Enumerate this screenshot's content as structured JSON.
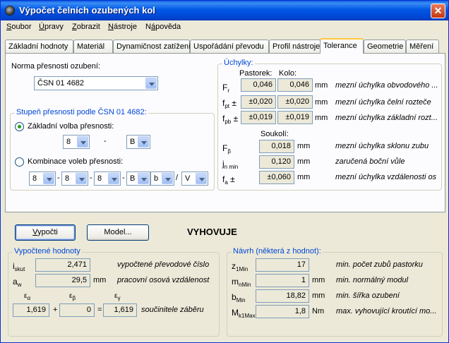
{
  "window": {
    "title": "Výpočet čelních ozubených kol",
    "close_symbol": "✕"
  },
  "menu": [
    {
      "pre": "",
      "acc": "S",
      "post": "oubor"
    },
    {
      "pre": "",
      "acc": "Ú",
      "post": "pravy"
    },
    {
      "pre": "",
      "acc": "Z",
      "post": "obrazit"
    },
    {
      "pre": "",
      "acc": "N",
      "post": "ástroje"
    },
    {
      "pre": "N",
      "acc": "á",
      "post": "pověda"
    }
  ],
  "tabs": [
    "Základní hodnoty",
    "Materiál",
    "Dynamičnost zatížení",
    "Uspořádání převodu",
    "Profil nástroje",
    "Tolerance",
    "Geometrie",
    "Měření"
  ],
  "active_tab": "Tolerance",
  "tolerance": {
    "norma_label": "Norma přesnosti ozubení:",
    "norma_value": "ČSN 01 4682",
    "stupen_title": "Stupeň přesnosti podle ČSN 01 4682:",
    "zakladni_label": "Základní volba přesnosti:",
    "zakladni_value1": "8",
    "dash": "-",
    "zakladni_value2": "B",
    "kombinace_label": "Kombinace voleb přesnosti:",
    "kombinace_values": [
      "8",
      "8",
      "8",
      "B",
      "b",
      "V"
    ],
    "kombinace_seps": [
      "-",
      "-",
      "-",
      "",
      "/"
    ],
    "uchylky_title": "Úchylky:",
    "pastorek_header": "Pastorek:",
    "kolo_header": "Kolo:",
    "soukoli_header": "Soukolí:",
    "rows": [
      {
        "sym": "F",
        "sub": "r",
        "suffix": "",
        "pastorek": "0,046",
        "kolo": "0,046",
        "unit": "mm",
        "desc": "mezní úchylka obvodového ..."
      },
      {
        "sym": "f",
        "sub": "pt",
        "suffix": " ±",
        "pastorek": "±0,020",
        "kolo": "±0,020",
        "unit": "mm",
        "desc": "mezní úchylka čelní rozteče"
      },
      {
        "sym": "f",
        "sub": "pb",
        "suffix": " ±",
        "pastorek": "±0,019",
        "kolo": "±0,019",
        "unit": "mm",
        "desc": "mezní úchylka základní rozt..."
      }
    ],
    "soukoli_rows": [
      {
        "sym": "F",
        "sub": "β",
        "suffix": "",
        "value": "0,018",
        "unit": "mm",
        "desc": "mezní úchylka sklonu zubu"
      },
      {
        "sym": "j",
        "sub": "n min",
        "suffix": "",
        "value": "0,120",
        "unit": "mm",
        "desc": "zaručená boční vůle"
      },
      {
        "sym": "f",
        "sub": "a",
        "suffix": " ±",
        "value": "±0,060",
        "unit": "mm",
        "desc": "mezní úchylka vzdálenosti os"
      }
    ]
  },
  "buttons": {
    "vypocti_pre": "",
    "vypocti_acc": "V",
    "vypocti_post": "ypočti",
    "model": "Model..."
  },
  "status": "VYHOVUJE",
  "vypoctene": {
    "title": "Vypočtené hodnoty",
    "rows": [
      {
        "sym": "i",
        "sub": "skut",
        "value": "2,471",
        "unit": "",
        "desc": "vypočtené převodové číslo"
      },
      {
        "sym": "a",
        "sub": "w",
        "value": "29,5",
        "unit": "mm",
        "desc": "pracovní osová vzdálenost"
      }
    ],
    "eps": [
      {
        "sym": "ε",
        "sub": "α",
        "value": "1,619"
      },
      {
        "sym": "ε",
        "sub": "β",
        "value": "0"
      },
      {
        "sym": "ε",
        "sub": "γ",
        "value": "1,619"
      }
    ],
    "plus": "+",
    "equals": "=",
    "eps_desc": "součinitele záběru"
  },
  "navrh": {
    "title": "Návrh (některá z hodnot):",
    "rows": [
      {
        "sym": "z",
        "sub": "1Min",
        "value": "17",
        "unit": "",
        "desc": "min. počet zubů pastorku"
      },
      {
        "sym": "m",
        "sub": "nMin",
        "value": "1",
        "unit": "mm",
        "desc": "min. normálný modul"
      },
      {
        "sym": "b",
        "sub": "Min",
        "value": "18,82",
        "unit": "mm",
        "desc": "min. šířka ozubení"
      },
      {
        "sym": "M",
        "sub": "k1Max",
        "value": "1,8",
        "unit": "Nm",
        "desc": "max. vyhovující kroutící mo..."
      }
    ]
  }
}
